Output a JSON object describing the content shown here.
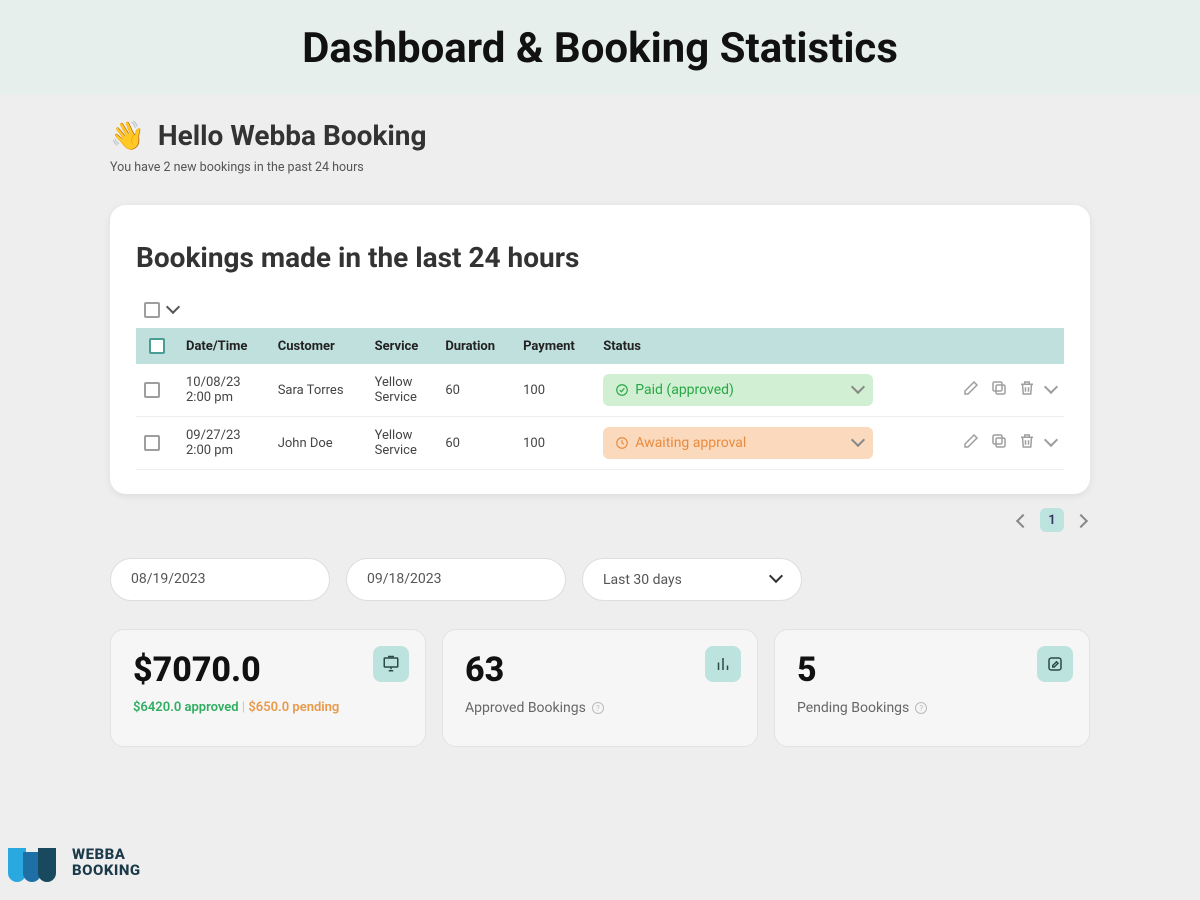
{
  "hero_title": "Dashboard & Booking Statistics",
  "greeting": {
    "emoji": "👋",
    "title": "Hello Webba Booking",
    "subtitle": "You have 2 new bookings in the past 24 hours"
  },
  "bookings_card": {
    "title": "Bookings made in the last 24 hours",
    "columns": {
      "datetime": "Date/Time",
      "customer": "Customer",
      "service": "Service",
      "duration": "Duration",
      "payment": "Payment",
      "status": "Status"
    },
    "rows": [
      {
        "date": "10/08/23",
        "time": "2:00 pm",
        "customer": "Sara Torres",
        "service": "Yellow Service",
        "duration": "60",
        "payment": "100",
        "status_label": "Paid (approved)",
        "status_kind": "paid"
      },
      {
        "date": "09/27/23",
        "time": "2:00 pm",
        "customer": "John Doe",
        "service": "Yellow Service",
        "duration": "60",
        "payment": "100",
        "status_label": "Awaiting approval",
        "status_kind": "await"
      }
    ],
    "page": "1"
  },
  "filters": {
    "from": "08/19/2023",
    "to": "09/18/2023",
    "range": "Last 30 days"
  },
  "stats": {
    "revenue_value": "$7070.0",
    "revenue_approved": "$6420.0 approved",
    "revenue_pending": "$650.0 pending",
    "approved_value": "63",
    "approved_label": "Approved Bookings",
    "pending_value": "5",
    "pending_label": "Pending Bookings"
  },
  "brand": {
    "line1": "WEBBA",
    "line2": "BOOKING"
  }
}
